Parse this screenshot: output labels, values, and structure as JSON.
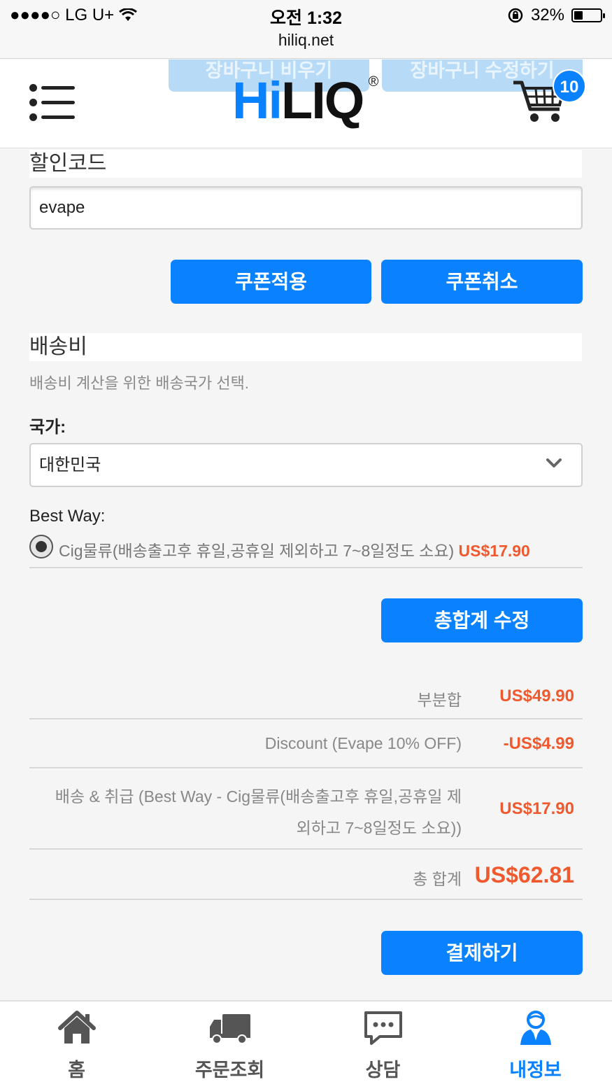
{
  "status_bar": {
    "carrier": "●●●●○ LG U+",
    "time": "오전 1:32",
    "url": "hiliq.net",
    "battery": "32%",
    "battery_level": 0.32
  },
  "header": {
    "ghost_buttons": [
      "장바구니 비우기",
      "장바구니 수정하기"
    ],
    "logo_hi": "Hi",
    "logo_liq": "LIQ",
    "logo_reg": "®",
    "cart_count": "10"
  },
  "coupon": {
    "title": "할인코드",
    "code_value": "evape",
    "apply_label": "쿠폰적용",
    "cancel_label": "쿠폰취소"
  },
  "shipping": {
    "title": "배송비",
    "hint": "배송비 계산을 위한 배송국가 선택.",
    "country_label": "국가:",
    "country_value": "대한민국",
    "method_label": "Best Way:",
    "option_text": "Cig물류(배송출고후 휴일,공휴일 제외하고 7~8일정도 소요)",
    "option_price": "US$17.90",
    "update_label": "총합계 수정"
  },
  "summary": {
    "subtotal_label": "부분합",
    "subtotal_value": "US$49.90",
    "discount_label": "Discount (Evape 10% OFF)",
    "discount_value": "-US$4.99",
    "shipping_label_line1": "배송 & 취급 (Best Way - Cig물류(배송출고후 휴일,공휴일 제",
    "shipping_label_line2": "외하고 7~8일정도 소요))",
    "shipping_value": "US$17.90",
    "total_label": "총 합계",
    "total_value": "US$62.81",
    "checkout_label": "결제하기"
  },
  "tabbar": {
    "tabs": [
      {
        "label": "홈",
        "icon": "home-icon"
      },
      {
        "label": "주문조회",
        "icon": "truck-icon"
      },
      {
        "label": "상담",
        "icon": "chat-icon"
      },
      {
        "label": "내정보",
        "icon": "user-icon"
      }
    ],
    "active_color": "#0a82ff"
  },
  "colors": {
    "accent": "#0a82ff",
    "price": "#f0582d"
  }
}
